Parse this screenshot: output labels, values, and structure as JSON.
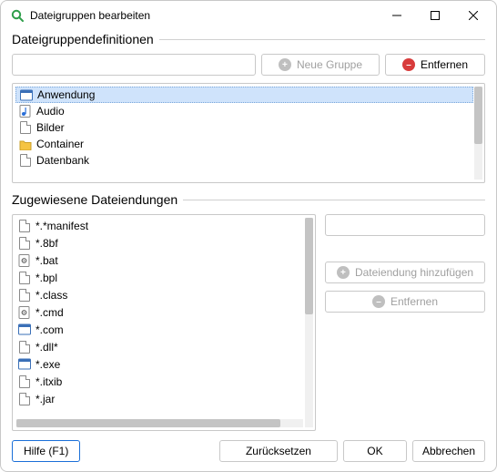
{
  "window": {
    "title": "Dateigruppen bearbeiten"
  },
  "sections": {
    "definitions": "Dateigruppendefinitionen",
    "extensions": "Zugewiesene Dateiendungen"
  },
  "buttons": {
    "new_group": "Neue Gruppe",
    "remove": "Entfernen",
    "add_ext": "Dateiendung hinzufügen",
    "remove_ext": "Entfernen",
    "help": "Hilfe (F1)",
    "reset": "Zurücksetzen",
    "ok": "OK",
    "cancel": "Abbrechen"
  },
  "groups": {
    "items": [
      {
        "label": "Anwendung",
        "icon": "window"
      },
      {
        "label": "Audio",
        "icon": "note"
      },
      {
        "label": "Bilder",
        "icon": "file"
      },
      {
        "label": "Container",
        "icon": "folder"
      },
      {
        "label": "Datenbank",
        "icon": "file"
      }
    ],
    "selected_index": 0
  },
  "extensions": {
    "items": [
      {
        "label": "*.*manifest",
        "icon": "file"
      },
      {
        "label": "*.8bf",
        "icon": "file"
      },
      {
        "label": "*.bat",
        "icon": "gear"
      },
      {
        "label": "*.bpl",
        "icon": "file"
      },
      {
        "label": "*.class",
        "icon": "file"
      },
      {
        "label": "*.cmd",
        "icon": "gear"
      },
      {
        "label": "*.com",
        "icon": "window"
      },
      {
        "label": "*.dll*",
        "icon": "file"
      },
      {
        "label": "*.exe",
        "icon": "window"
      },
      {
        "label": "*.itxib",
        "icon": "file"
      },
      {
        "label": "*.jar",
        "icon": "file"
      }
    ]
  }
}
